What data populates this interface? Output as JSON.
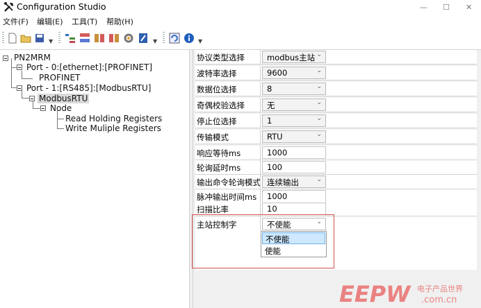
{
  "window": {
    "title": "Configuration Studio"
  },
  "menu": [
    "文件(F)",
    "编辑(E)",
    "工具(T)",
    "帮助(H)"
  ],
  "tree": {
    "root": "PN2MRM",
    "port0": "Port - 0:[ethernet]:[PROFINET]",
    "profinet": "PROFINET",
    "port1": "Port - 1:[RS485]:[ModbusRTU]",
    "modbus": "ModbusRTU",
    "node": "Node",
    "read_regs": "Read Holding Registers",
    "write_regs": "Write Muliple Registers"
  },
  "properties": [
    {
      "name": "协议类型选择",
      "value": "modbus主站",
      "type": "combo"
    },
    {
      "name": "波特率选择",
      "value": "9600",
      "type": "combo"
    },
    {
      "name": "数据位选择",
      "value": "8",
      "type": "combo"
    },
    {
      "name": "奇偶校验选择",
      "value": "无",
      "type": "combo"
    },
    {
      "name": "停止位选择",
      "value": "1",
      "type": "combo"
    },
    {
      "name": "传输模式",
      "value": "RTU",
      "type": "combo"
    },
    {
      "name": "响应等待ms",
      "value": "1000",
      "type": "text"
    },
    {
      "name": "轮询延时ms",
      "value": "100",
      "type": "text"
    },
    {
      "name": "输出命令轮询模式",
      "value": "连续输出",
      "type": "combo"
    },
    {
      "name": "脉冲输出时间ms",
      "value": "1000",
      "type": "text"
    },
    {
      "name": "扫描比率",
      "value": "10",
      "type": "text"
    },
    {
      "name": "主站控制字",
      "value": "不使能",
      "type": "combo"
    }
  ],
  "dropdown_options": [
    "不使能",
    "使能"
  ],
  "watermark": {
    "logo": "EEPW",
    "site_cn": "电子产品世界",
    "domain": ".com.cn"
  },
  "colors": {
    "highlight": "#d05050",
    "selected_option": "#cde8ff",
    "watermark": "#e8716f"
  }
}
